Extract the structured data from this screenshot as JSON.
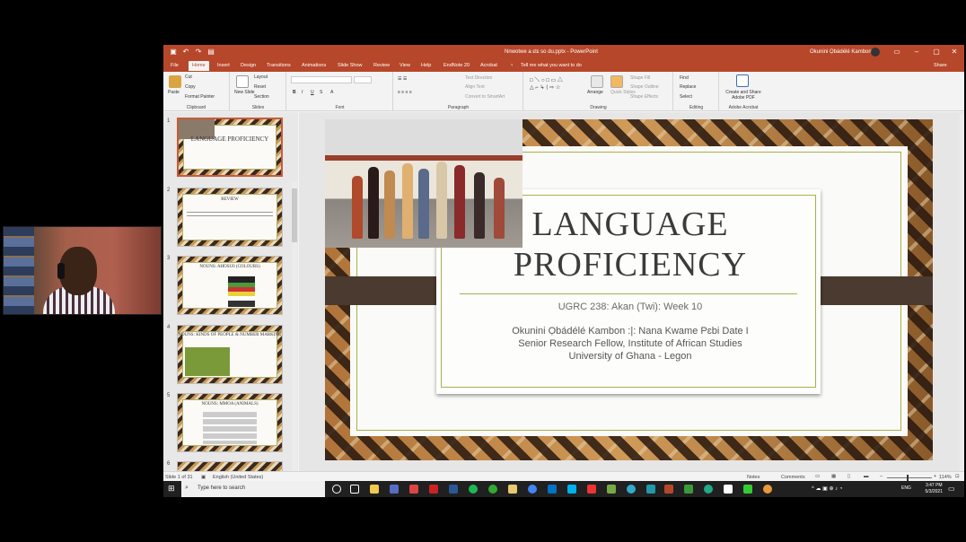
{
  "window": {
    "doc_title": "Nnwotwe a ɛtɛ so du.pptx  -  PowerPoint",
    "user": "Okunini Ọbádélé Kambon",
    "share": "Share",
    "tell_me": "Tell me what you want to do"
  },
  "tabs": [
    "File",
    "Home",
    "Insert",
    "Design",
    "Transitions",
    "Animations",
    "Slide Show",
    "Review",
    "View",
    "Help",
    "EndNote 20",
    "Acrobat"
  ],
  "ribbon": {
    "clipboard": {
      "label": "Clipboard",
      "paste": "Paste",
      "cut": "Cut",
      "copy": "Copy",
      "format_painter": "Format Painter"
    },
    "slides": {
      "label": "Slides",
      "new_slide": "New Slide",
      "layout": "Layout",
      "reset": "Reset",
      "section": "Section"
    },
    "font": {
      "label": "Font"
    },
    "paragraph": {
      "label": "Paragraph",
      "text_direction": "Text Direction",
      "align_text": "Align Text",
      "convert": "Convert to SmartArt"
    },
    "drawing": {
      "label": "Drawing",
      "arrange": "Arrange",
      "quick_styles": "Quick Styles",
      "shape_fill": "Shape Fill",
      "shape_outline": "Shape Outline",
      "shape_effects": "Shape Effects"
    },
    "editing": {
      "label": "Editing",
      "find": "Find",
      "replace": "Replace",
      "select": "Select"
    },
    "acrobat": {
      "label": "Adobe Acrobat",
      "create": "Create and Share Adobe PDF"
    }
  },
  "thumbnails": [
    {
      "num": "1",
      "title": "LANGUAGE PROFICIENCY"
    },
    {
      "num": "2",
      "title": "REVIEW"
    },
    {
      "num": "3",
      "title": "NOUNS: AHOSU0 (COLOURS)"
    },
    {
      "num": "4",
      "title": "NOUNS: KINDS OF PEOPLE & NUMBER MARKING"
    },
    {
      "num": "5",
      "title": "NOUNS: MMOA (ANIMALS)"
    },
    {
      "num": "6",
      "title": ""
    }
  ],
  "slide": {
    "title_line1": "LANGUAGE",
    "title_line2": "PROFICIENCY",
    "subtitle": "UGRC 238: Akan (Twi): Week 10",
    "author_line1": "Okunini Ọbádélé Kambon :|: Nana Kwame Pɛbi Date I",
    "author_line2": "Senior Research Fellow, Institute of African Studies",
    "author_line3": "University of Ghana - Legon"
  },
  "status": {
    "slide_of": "Slide 1 of 31",
    "language": "English (United States)",
    "notes": "Notes",
    "comments": "Comments",
    "zoom": "114%"
  },
  "taskbar": {
    "search_placeholder": "Type here to search",
    "time": "3:47 PM",
    "date": "5/3/2021",
    "lang": "ENG"
  }
}
